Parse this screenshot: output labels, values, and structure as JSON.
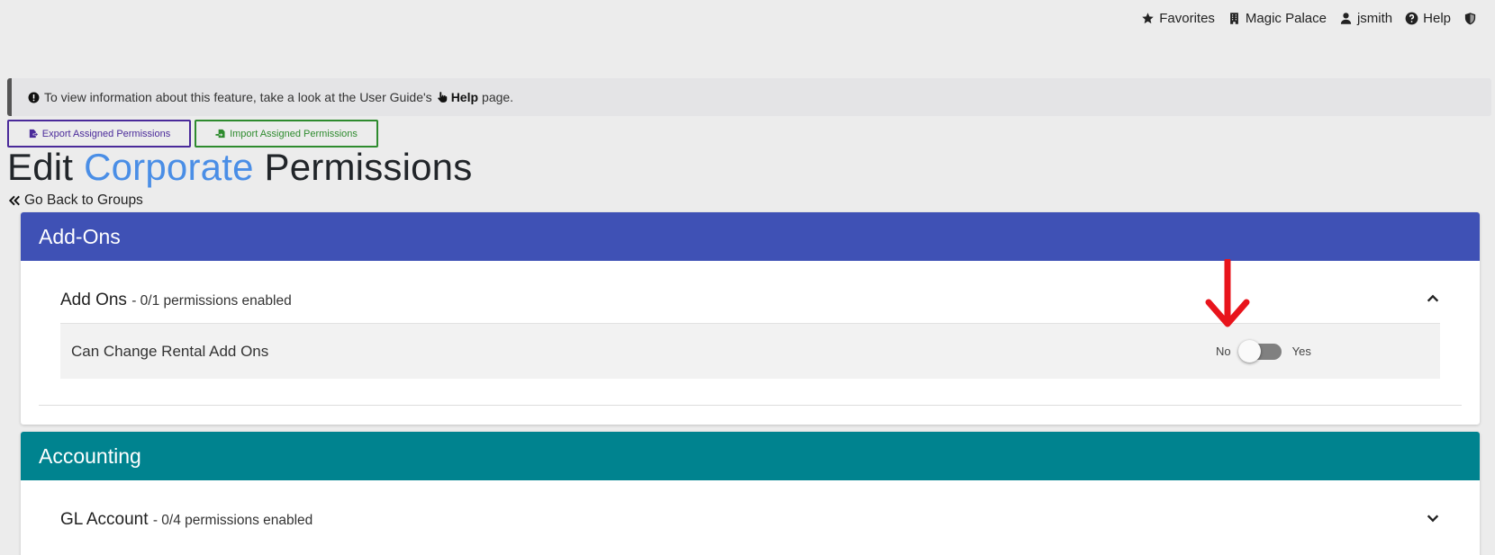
{
  "topnav": {
    "favorites": "Favorites",
    "property": "Magic Palace",
    "user": "jsmith",
    "help": "Help"
  },
  "alert": {
    "text_before": "To view information about this feature, take a look at the User Guide's",
    "link": "Help",
    "text_after": "page."
  },
  "actions": {
    "export": "Export Assigned Permissions",
    "import": "Import Assigned Permissions"
  },
  "title": {
    "prefix": "Edit",
    "group": "Corporate",
    "suffix": "Permissions"
  },
  "back_link": "Go Back to Groups",
  "sections": [
    {
      "header": "Add-Ons",
      "group_title": "Add Ons",
      "group_count": "- 0/1 permissions enabled",
      "expanded": true,
      "permissions": [
        {
          "label": "Can Change Rental Add Ons",
          "no": "No",
          "yes": "Yes",
          "enabled": false
        }
      ]
    },
    {
      "header": "Accounting",
      "group_title": "GL Account",
      "group_count": "- 0/4 permissions enabled",
      "expanded": false
    }
  ],
  "colors": {
    "addons_header": "#3f51b5",
    "accounting_header": "#00838f",
    "accent": "#4a8ee6",
    "annotation_arrow": "#e8141c"
  }
}
